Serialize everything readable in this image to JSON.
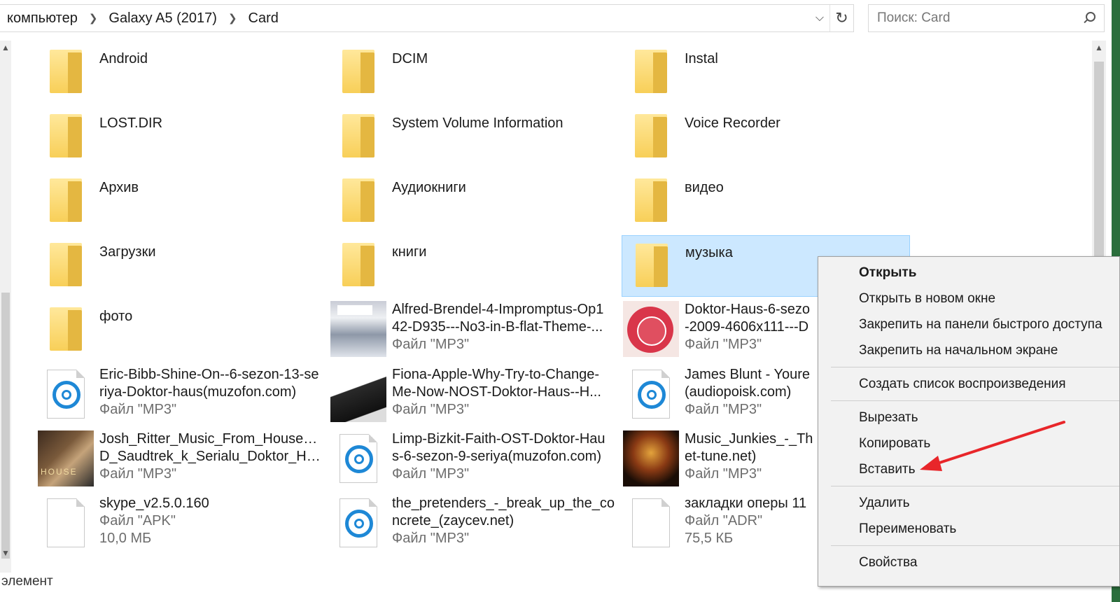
{
  "breadcrumb": {
    "items": [
      "компьютер",
      "Galaxy A5 (2017)",
      "Card"
    ]
  },
  "search": {
    "placeholder": "Поиск: Card"
  },
  "folders": [
    "Android",
    "DCIM",
    "Instal",
    "LOST.DIR",
    "System Volume Information",
    "Voice Recorder",
    "Архив",
    "Аудиокниги",
    "видео",
    "Загрузки",
    "книги",
    "музыка",
    "фото"
  ],
  "files": [
    {
      "name": "Alfred-Brendel-4-Impromptus-Op1",
      "name2": "42-D935---No3-in-B-flat-Theme-...",
      "type": "Файл \"MP3\""
    },
    {
      "name": "Doktor-Haus-6-sezo",
      "name2": "-2009-4606x111---D",
      "type": "Файл \"MP3\""
    },
    {
      "name": "Eric-Bibb-Shine-On--6-sezon-13-se",
      "name2": "riya-Doktor-haus(muzofon.com)",
      "type": "Файл \"MP3\""
    },
    {
      "name": "Fiona-Apple-Why-Try-to-Change-",
      "name2": "Me-Now-NOST-Doktor-Haus--H...",
      "type": "Файл \"MP3\""
    },
    {
      "name": "James Blunt - Youre",
      "name2": "(audiopoisk.com)",
      "type": "Файл \"MP3\""
    },
    {
      "name": "Josh_Ritter_Music_From_House_M_",
      "name2": "D_Saudtrek_k_Serialu_Doktor_Hau...",
      "type": "Файл \"MP3\""
    },
    {
      "name": "Limp-Bizkit-Faith-OST-Doktor-Hau",
      "name2": "s-6-sezon-9-seriya(muzofon.com)",
      "type": "Файл \"MP3\""
    },
    {
      "name": "Music_Junkies_-_Th",
      "name2": "et-tune.net)",
      "type": "Файл \"MP3\""
    },
    {
      "name": "skype_v2.5.0.160",
      "type": "Файл \"APK\"",
      "size": "10,0 МБ"
    },
    {
      "name": "the_pretenders_-_break_up_the_co",
      "name2": "ncrete_(zaycev.net)",
      "type": "Файл \"MP3\""
    },
    {
      "name": "закладки оперы 11",
      "type": "Файл \"ADR\"",
      "size": "75,5 КБ"
    }
  ],
  "status_text": "элемент",
  "context_menu": [
    "Открыть",
    "Открыть в новом окне",
    "Закрепить на панели быстрого доступа",
    "Закрепить на начальном экране",
    "Создать список воспроизведения",
    "Вырезать",
    "Копировать",
    "Вставить",
    "Удалить",
    "Переименовать",
    "Свойства"
  ],
  "colors": {
    "selection": "#cce8ff",
    "folder": "#f8cf58",
    "accent": "#1e88d6",
    "arrow": "#e8262a"
  },
  "icons": {
    "folder": "folder-icon",
    "mp3": "audio-file-icon",
    "blank": "blank-file-icon",
    "search": "search-icon"
  }
}
